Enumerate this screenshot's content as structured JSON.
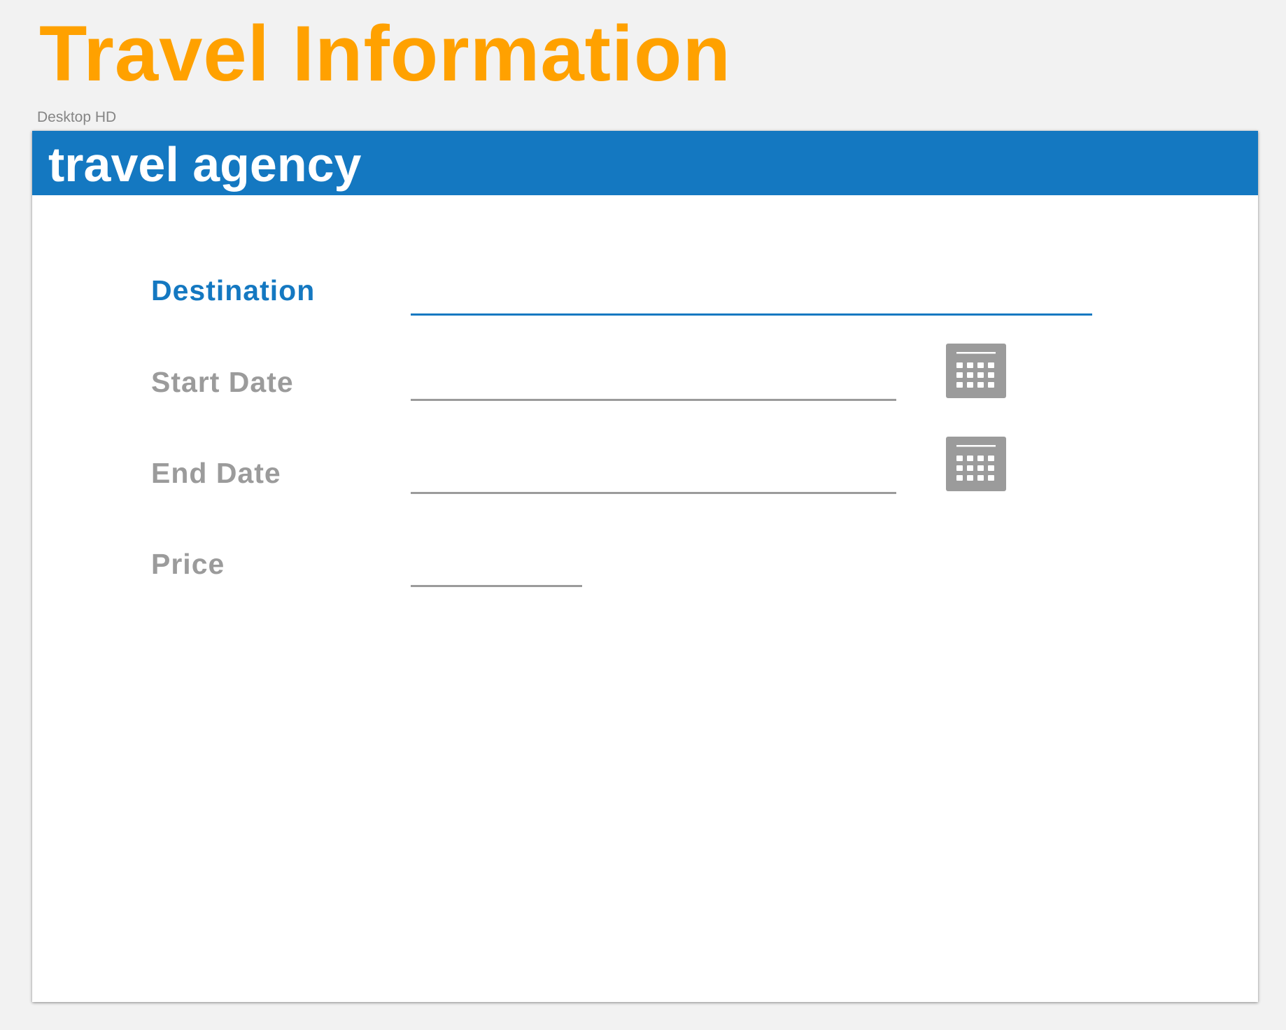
{
  "page": {
    "title": "Travel Information",
    "artboard_label": "Desktop HD"
  },
  "header": {
    "brand": "travel agency"
  },
  "form": {
    "destination": {
      "label": "Destination",
      "value": ""
    },
    "start_date": {
      "label": "Start Date",
      "value": "",
      "icon": "calendar-icon"
    },
    "end_date": {
      "label": "End Date",
      "value": "",
      "icon": "calendar-icon"
    },
    "price": {
      "label": "Price",
      "value": ""
    }
  },
  "colors": {
    "title": "#FFA100",
    "header_bg": "#1478C1",
    "accent": "#1478C1",
    "muted": "#9b9b9b",
    "canvas": "#f2f2f2"
  }
}
